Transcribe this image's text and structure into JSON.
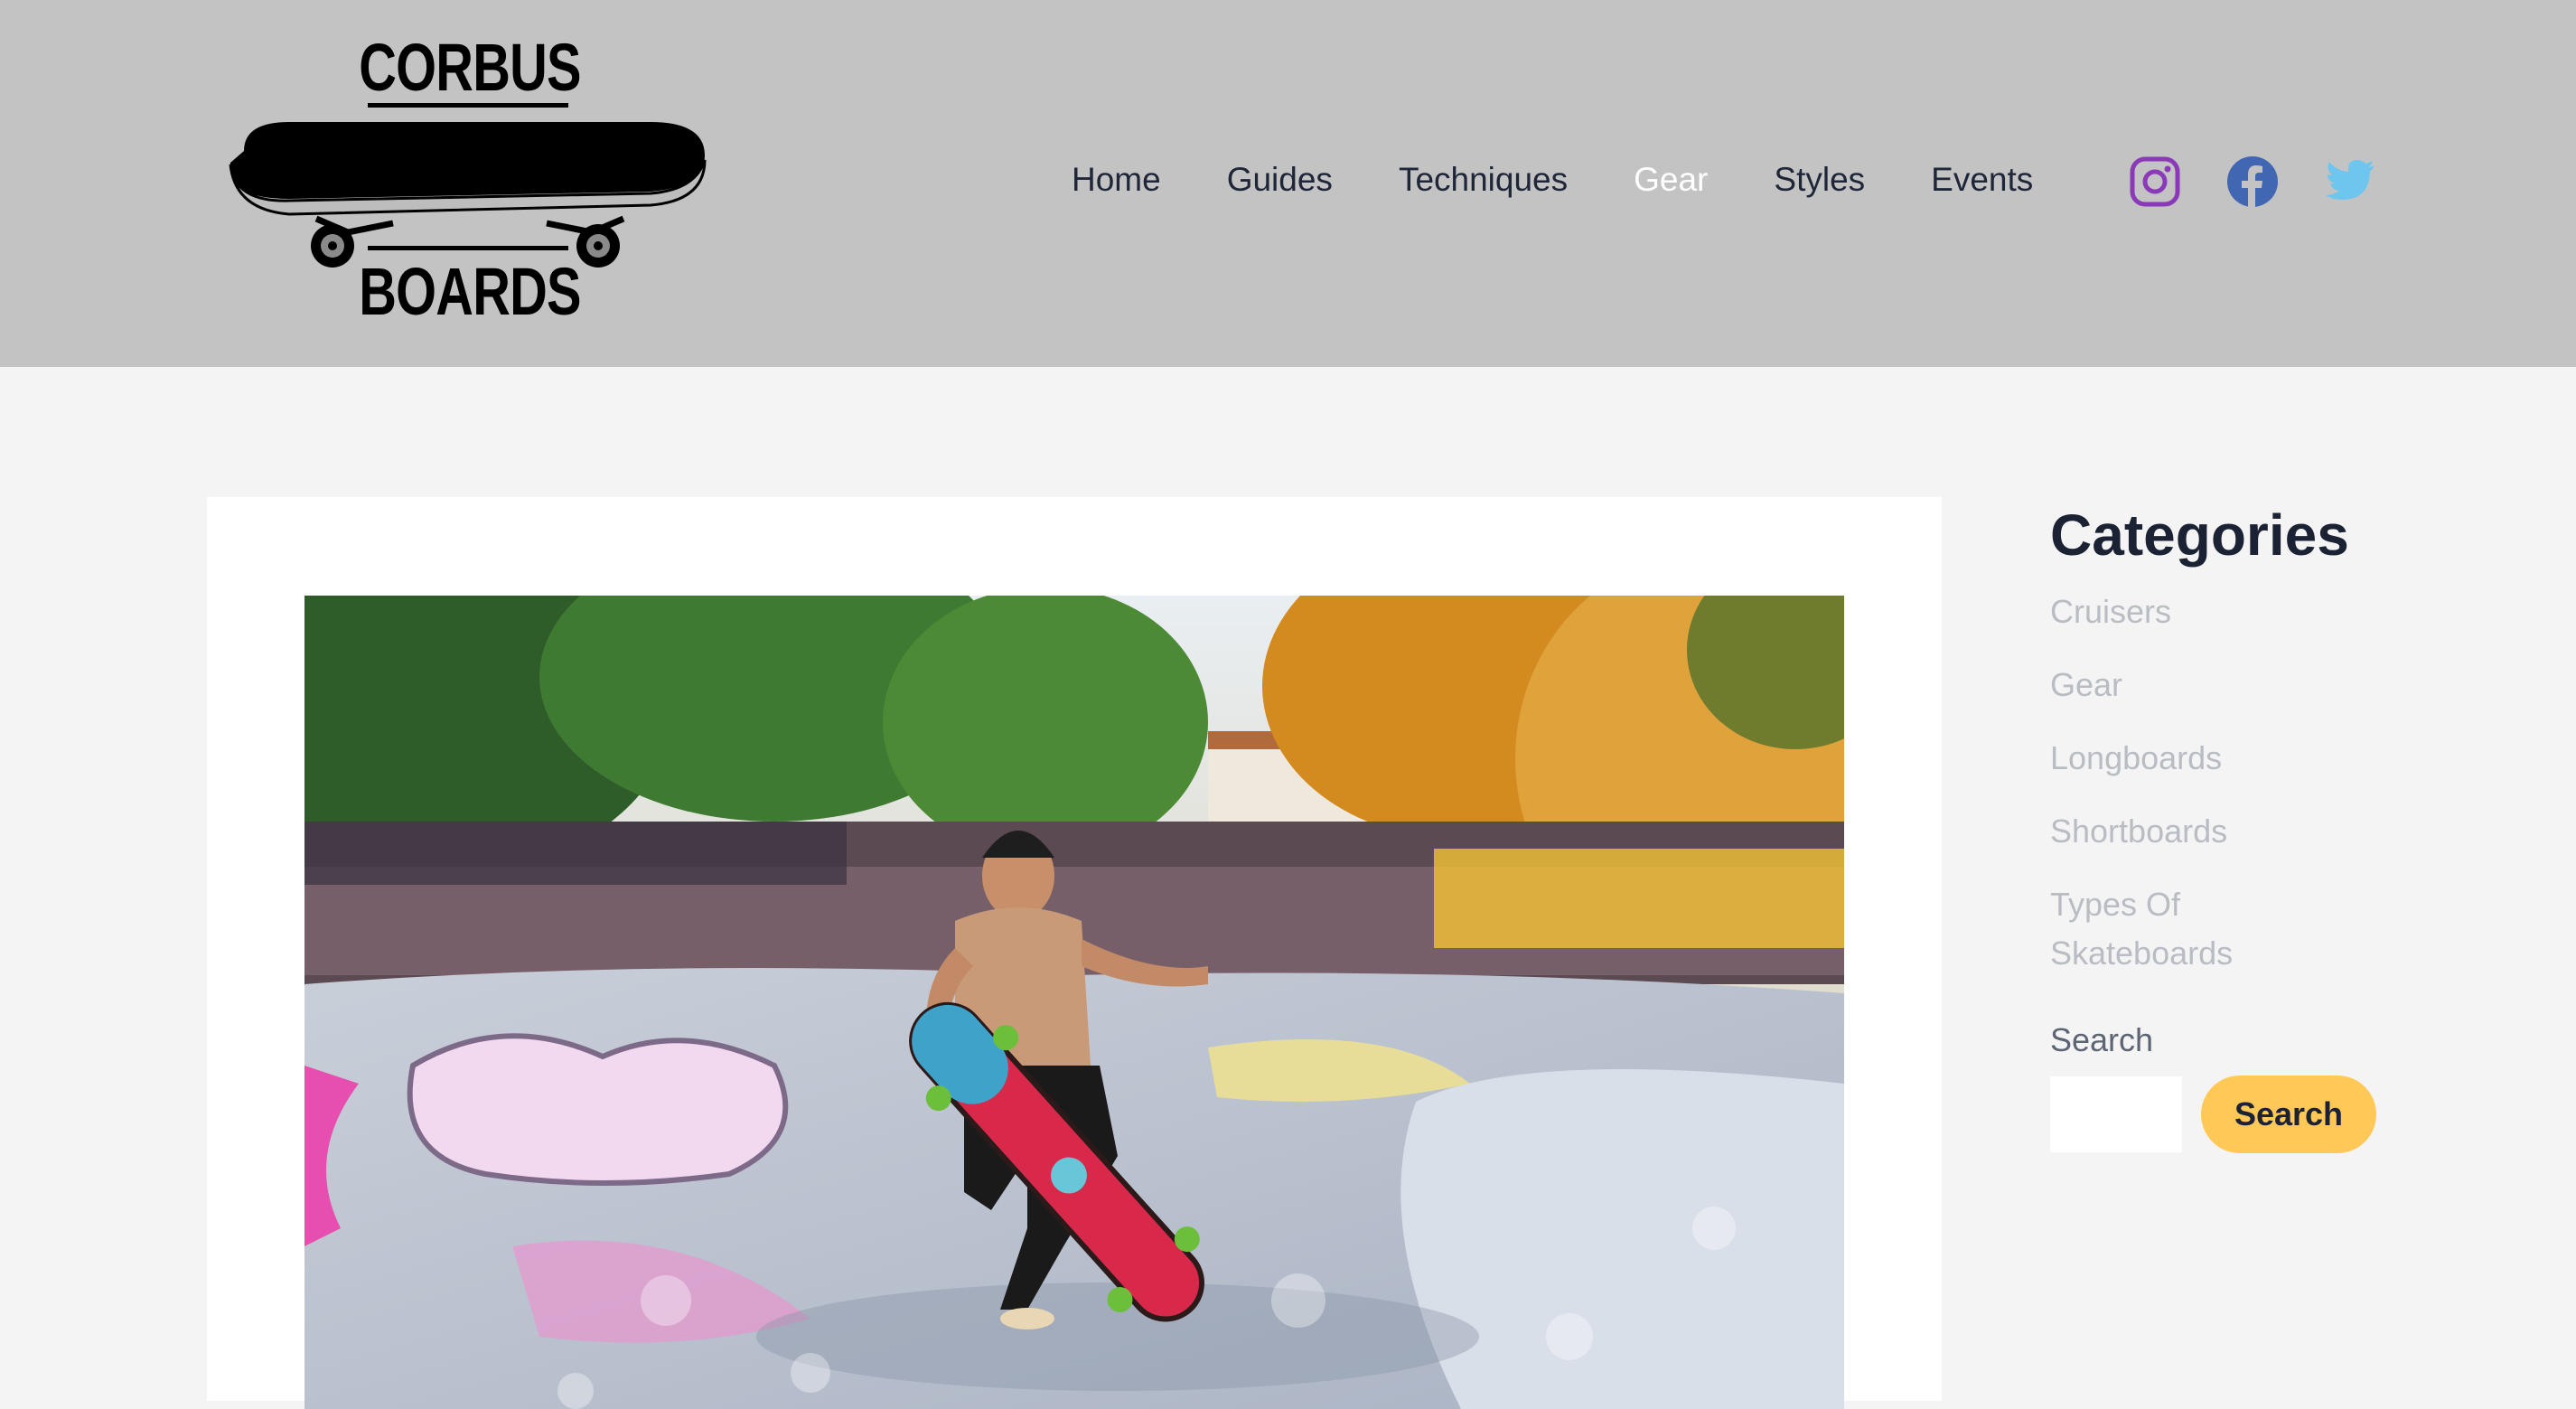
{
  "brand": {
    "logo_top": "CORBUS",
    "logo_bottom": "BOARDS"
  },
  "nav": {
    "items": [
      {
        "label": "Home",
        "active": false
      },
      {
        "label": "Guides",
        "active": false
      },
      {
        "label": "Techniques",
        "active": false
      },
      {
        "label": "Gear",
        "active": true
      },
      {
        "label": "Styles",
        "active": false
      },
      {
        "label": "Events",
        "active": false
      }
    ]
  },
  "social": [
    {
      "icon": "instagram-icon",
      "color": "#8a3ab9"
    },
    {
      "icon": "facebook-icon",
      "color": "#4267b2"
    },
    {
      "icon": "twitter-icon",
      "color": "#6ec6ee"
    }
  ],
  "sidebar": {
    "title": "Categories",
    "categories": [
      "Cruisers",
      "Gear",
      "Longboards",
      "Shortboards",
      "Types Of Skateboards"
    ],
    "search_label": "Search",
    "search_placeholder": "",
    "search_button": "Search"
  },
  "article": {
    "image_icon": "skatepark-photo"
  },
  "colors": {
    "header_bg": "#c3c3c3",
    "page_bg": "#f4f4f4",
    "accent": "#ffc857",
    "text_dark": "#1b2233",
    "category_text": "#b9bcc2"
  }
}
